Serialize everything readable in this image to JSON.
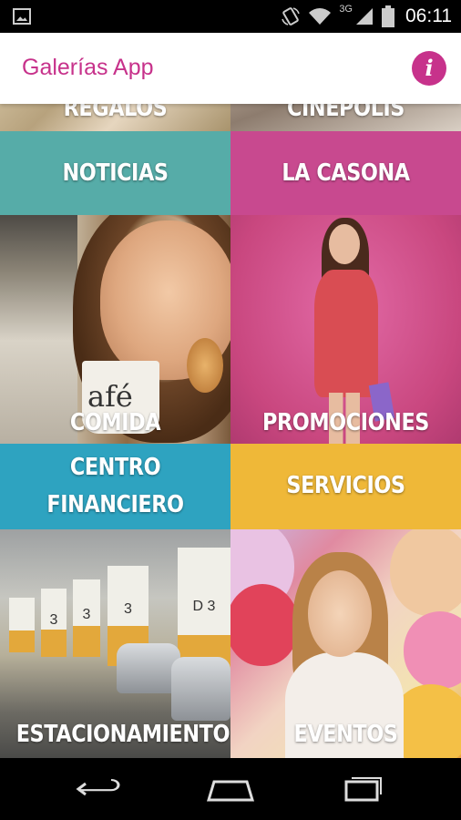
{
  "status_bar": {
    "network": "3G",
    "time": "06:11"
  },
  "app_bar": {
    "title": "Galerías App",
    "info_glyph": "i",
    "accent_color": "#c7328b"
  },
  "tiles": [
    {
      "id": "regalos",
      "label": "REGALOS",
      "kind": "photo"
    },
    {
      "id": "cinepolis",
      "label": "CINEPOLIS",
      "kind": "photo"
    },
    {
      "id": "noticias",
      "label": "NOTICIAS",
      "kind": "solid",
      "color": "#56aca8"
    },
    {
      "id": "la-casona",
      "label": "LA CASONA",
      "kind": "solid",
      "color": "#c8498f"
    },
    {
      "id": "comida",
      "label": "COMIDA",
      "kind": "photo"
    },
    {
      "id": "promociones",
      "label": "PROMOCIONES",
      "kind": "photo"
    },
    {
      "id": "centro-financiero",
      "label_lines": [
        "CENTRO",
        "FINANCIERO"
      ],
      "kind": "solid",
      "color": "#2ea3c0"
    },
    {
      "id": "servicios",
      "label": "SERVICIOS",
      "kind": "solid",
      "color": "#efb838"
    },
    {
      "id": "estacionamiento",
      "label": "ESTACIONAMIENTO",
      "kind": "photo"
    },
    {
      "id": "eventos",
      "label": "EVENTOS",
      "kind": "photo"
    }
  ],
  "photo_text": {
    "cup_text": "afé",
    "pillar_1": "3",
    "pillar_2": "3",
    "pillar_3": "3",
    "pillar_4": "D 3"
  },
  "icons": [
    "image-icon",
    "rotate-icon",
    "wifi-icon",
    "signal-icon",
    "battery-icon",
    "info-icon",
    "back-icon",
    "home-icon",
    "recents-icon"
  ]
}
